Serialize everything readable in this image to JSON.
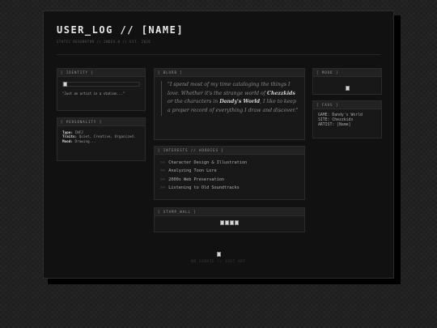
{
  "header": {
    "title": "USER_LOG // [NAME]",
    "subtitle": "STATIC RESONATOR // INDEX.H // EST. 2026"
  },
  "identity": {
    "heading": "[ IDENTITY ]",
    "status": "\"Just an artist in a station...\""
  },
  "personality": {
    "heading": "[ PERSONALITY ]",
    "type_label": "Type:",
    "type_value": "INFJ",
    "traits_label": "Traits:",
    "traits_value": "Quiet, Creative, Organized.",
    "mood_label": "Mood:",
    "mood_value": "Drawing..."
  },
  "blurb": {
    "heading": "[ BLURB ]",
    "part1": "\"I spend most of my time cataloging the things I love. Whether it's the strange world of ",
    "bold1": "Chezzkids",
    "part2": " or the characters in ",
    "bold2": "Dandy's World",
    "part3": ", I like to keep a proper record of everything I draw and discover.\""
  },
  "interests": {
    "heading": "[ INTERESTS // HOBBIES ]",
    "arrow": ">>",
    "items": [
      "Character Design & Illustration",
      "Analyzing Toon Lore",
      "2000s Web Preservation",
      "Listening to Old Soundtracks"
    ]
  },
  "stamp_wall": {
    "heading": "[ STAMP_WALL ]"
  },
  "mood": {
    "heading": "[ MOOD ]"
  },
  "favs": {
    "heading": "[ FAVS ]",
    "game_label": "GAME:",
    "game_value": "Dandy's World",
    "site_label": "SITE:",
    "site_value": "Chezzkids",
    "artist_label": "ARTIST:",
    "artist_value": "[Name]"
  },
  "footer": {
    "text": "NO COOKIE // JUST ART"
  }
}
